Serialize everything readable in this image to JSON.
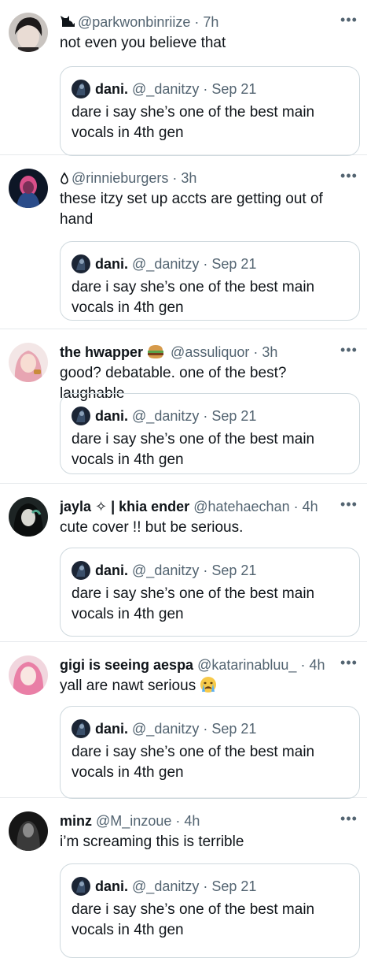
{
  "quoted_tweet": {
    "name": "dani.",
    "handle": "@_danitzy",
    "separator": " · ",
    "date": "Sep 21",
    "text": "dare i say she’s one of the best main vocals in 4th gen"
  },
  "tweets": [
    {
      "name": "",
      "deco": "cat-icon",
      "handle": "@parkwonbinriize",
      "time": "7h",
      "text": "not even you believe that"
    },
    {
      "name": "",
      "deco": "drop-icon",
      "handle": "@rinnieburgers",
      "time": "3h",
      "text": "these itzy set up accts are getting out of hand"
    },
    {
      "name": "the hwapper",
      "deco": "burger-emoji",
      "handle": "@assuliquor",
      "time": "3h",
      "text": "good? debatable. one of the best? laughable"
    },
    {
      "name": "jayla ✧ | khia ender",
      "handle": "@hatehaechan",
      "time": "4h",
      "text": "cute cover !! but be serious."
    },
    {
      "name": "gigi is seeing aespa",
      "handle": "@katarinabluu_",
      "time": "4h",
      "text": "yall are nawt serious",
      "emoji": "crying-face-emoji"
    },
    {
      "name": "minz",
      "handle": "@M_inzoue",
      "time": "4h",
      "text": "i’m screaming this is terrible"
    }
  ],
  "separator": " · ",
  "more_label": "•••",
  "colors": {
    "secondary_text": "#536471",
    "border": "#cfd9de",
    "primary_text": "#0f1419"
  }
}
